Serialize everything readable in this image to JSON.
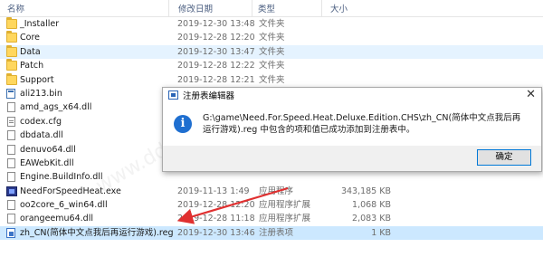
{
  "header": {
    "name": "名称",
    "date": "修改日期",
    "type": "类型",
    "size": "大小"
  },
  "files": [
    {
      "name": "_Installer",
      "date": "2019-12-30 13:48",
      "type": "文件夹",
      "size": "",
      "kind": "folder"
    },
    {
      "name": "Core",
      "date": "2019-12-28 12:20",
      "type": "文件夹",
      "size": "",
      "kind": "folder"
    },
    {
      "name": "Data",
      "date": "2019-12-30 13:47",
      "type": "文件夹",
      "size": "",
      "kind": "folder"
    },
    {
      "name": "Patch",
      "date": "2019-12-28 12:22",
      "type": "文件夹",
      "size": "",
      "kind": "folder"
    },
    {
      "name": "Support",
      "date": "2019-12-28 12:21",
      "type": "文件夹",
      "size": "",
      "kind": "folder"
    },
    {
      "name": "ali213.bin",
      "date": "",
      "type": "",
      "size": "",
      "kind": "bin"
    },
    {
      "name": "amd_ags_x64.dll",
      "date": "",
      "type": "",
      "size": "",
      "kind": "file"
    },
    {
      "name": "codex.cfg",
      "date": "",
      "type": "",
      "size": "",
      "kind": "cfg"
    },
    {
      "name": "dbdata.dll",
      "date": "",
      "type": "",
      "size": "",
      "kind": "file"
    },
    {
      "name": "denuvo64.dll",
      "date": "",
      "type": "",
      "size": "",
      "kind": "file"
    },
    {
      "name": "EAWebKit.dll",
      "date": "",
      "type": "",
      "size": "",
      "kind": "file"
    },
    {
      "name": "Engine.BuildInfo.dll",
      "date": "",
      "type": "",
      "size": "",
      "kind": "file"
    },
    {
      "name": "NeedForSpeedHeat.exe",
      "date": "2019-11-13 1:49",
      "type": "应用程序",
      "size": "343,185 KB",
      "kind": "exe"
    },
    {
      "name": "oo2core_6_win64.dll",
      "date": "2019-12-28 12:20",
      "type": "应用程序扩展",
      "size": "1,068 KB",
      "kind": "file"
    },
    {
      "name": "orangeemu64.dll",
      "date": "2019-12-28 11:18",
      "type": "应用程序扩展",
      "size": "2,083 KB",
      "kind": "file"
    },
    {
      "name": "zh_CN(简体中文点我后再运行游戏).reg",
      "date": "2019-12-30 13:46",
      "type": "注册表项",
      "size": "1 KB",
      "kind": "reg"
    }
  ],
  "dialog": {
    "title": "注册表编辑器",
    "message": "G:\\game\\Need.For.Speed.Heat.Deluxe.Edition.CHS\\zh_CN(简体中文点我后再运行游戏).reg 中包含的项和值已成功添加到注册表中。",
    "ok_label": "确定",
    "close_glyph": "✕",
    "info_glyph": "i"
  },
  "colors": {
    "selected_row": "#cce8ff",
    "highlight_row": "#e5f3ff",
    "arrow": "#e03030",
    "accent": "#0078d7"
  }
}
